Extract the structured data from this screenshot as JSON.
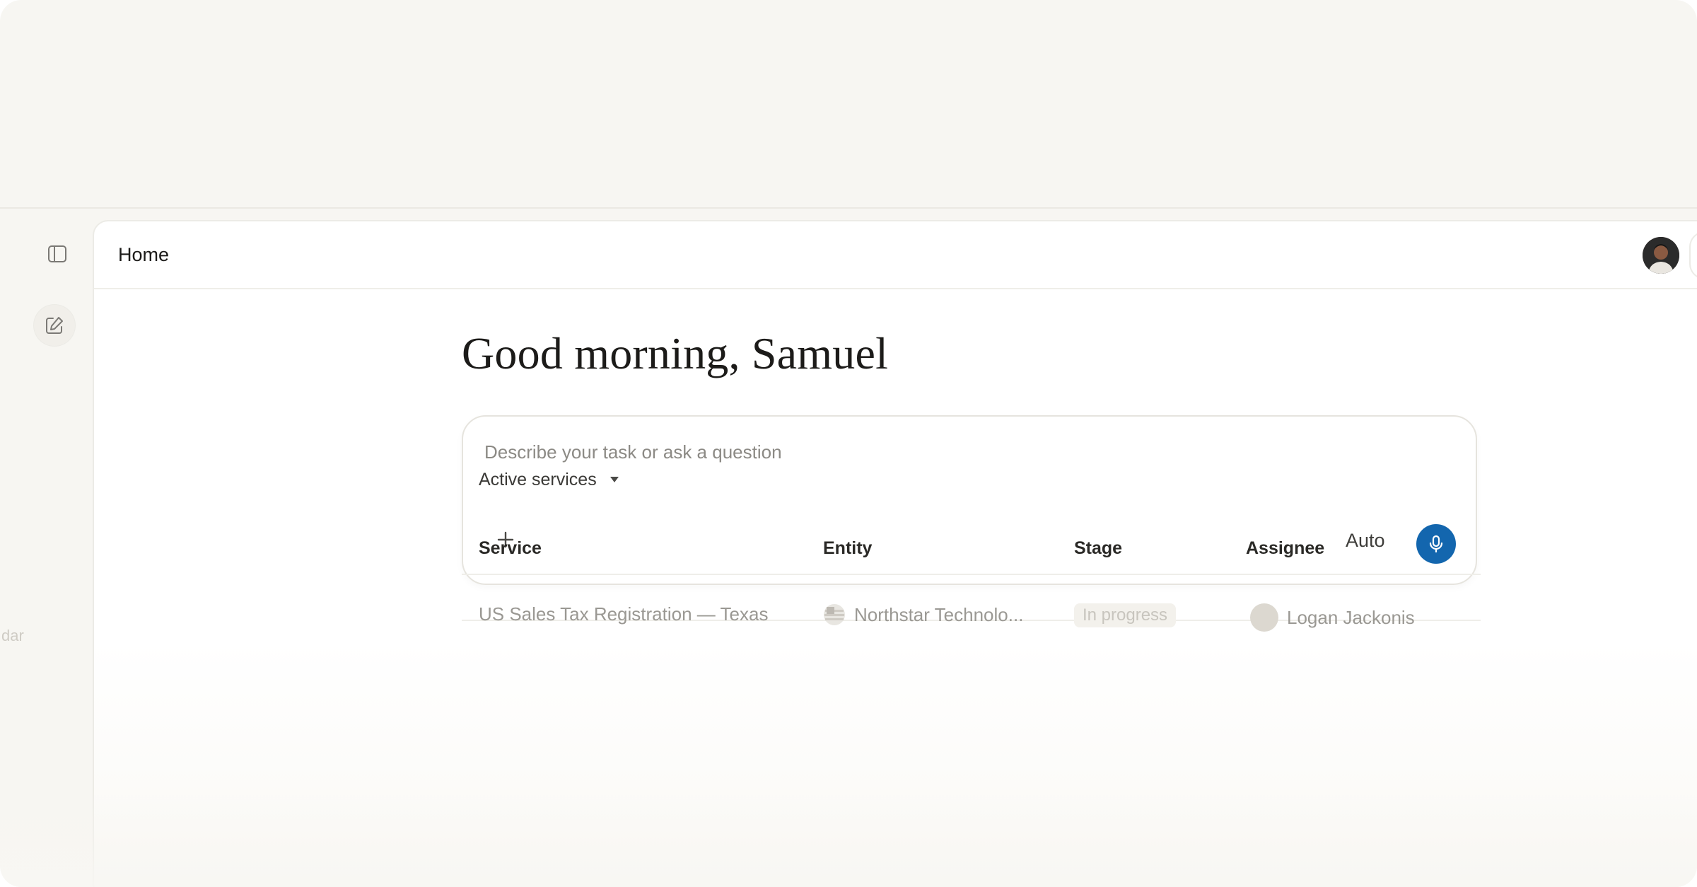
{
  "header": {
    "title": "Home"
  },
  "greeting": "Good morning, Samuel",
  "prompt": {
    "placeholder": "Describe your task or ask a question",
    "mode": "Auto"
  },
  "sidebar": {
    "faded_label": "dar"
  },
  "services": {
    "filter_label": "Active services",
    "columns": [
      "Service",
      "Entity",
      "Stage",
      "Assignee"
    ],
    "rows": [
      {
        "service": "US Sales Tax Registration — Texas",
        "entity": "Northstar Technolo...",
        "stage": "In progress",
        "assignee": "Logan Jackonis"
      }
    ]
  },
  "colors": {
    "accent": "#1366ae",
    "background": "#f7f6f2",
    "card": "#ffffff",
    "text": "#1c1b19"
  },
  "icons": {
    "sidebar_toggle": "sidebar-toggle-icon",
    "compose": "compose-icon",
    "add": "plus-icon",
    "mic": "microphone-icon",
    "dropdown": "caret-down-icon",
    "entity_flag": "us-flag-icon"
  }
}
